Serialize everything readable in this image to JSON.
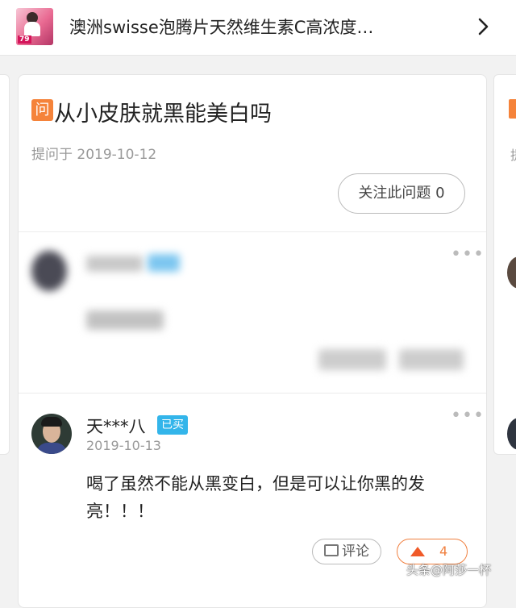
{
  "header": {
    "product_title": "澳洲swisse泡腾片天然维生素C高浓度…",
    "thumbnail_badge": "79"
  },
  "question": {
    "badge": "问",
    "title": "从小皮肤就黑能美白吗",
    "date": "提问于 2019-10-12",
    "follow_label": "关注此问题 0"
  },
  "answers": [
    {
      "user": "天***八",
      "badge": "已买",
      "date": "2019-10-13",
      "text": "喝了虽然不能从黑变白，但是可以让你黑的发亮！！！",
      "comment_label": "评论",
      "like_count": "4"
    }
  ],
  "watermark": "头条@阿莎一杯",
  "colors": {
    "accent_orange": "#f5833a",
    "badge_blue": "#33b5ea"
  }
}
